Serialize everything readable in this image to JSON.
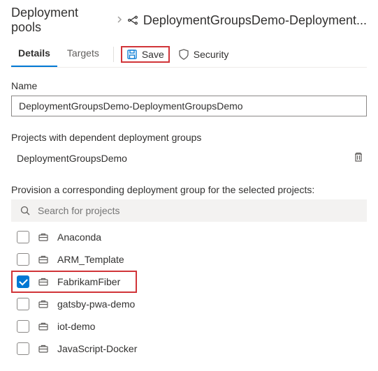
{
  "breadcrumb": {
    "root": "Deployment pools",
    "leaf": "DeploymentGroupsDemo-Deployment..."
  },
  "tabs": {
    "details": "Details",
    "targets": "Targets"
  },
  "toolbar": {
    "save": "Save",
    "security": "Security"
  },
  "nameField": {
    "label": "Name",
    "value": "DeploymentGroupsDemo-DeploymentGroupsDemo"
  },
  "dependent": {
    "label": "Projects with dependent deployment groups",
    "items": [
      "DeploymentGroupsDemo"
    ]
  },
  "provision": {
    "label": "Provision a corresponding deployment group for the selected projects:",
    "searchPlaceholder": "Search for projects",
    "projects": [
      {
        "name": "Anaconda",
        "checked": false
      },
      {
        "name": "ARM_Template",
        "checked": false
      },
      {
        "name": "FabrikamFiber",
        "checked": true
      },
      {
        "name": "gatsby-pwa-demo",
        "checked": false
      },
      {
        "name": "iot-demo",
        "checked": false
      },
      {
        "name": "JavaScript-Docker",
        "checked": false
      }
    ]
  }
}
